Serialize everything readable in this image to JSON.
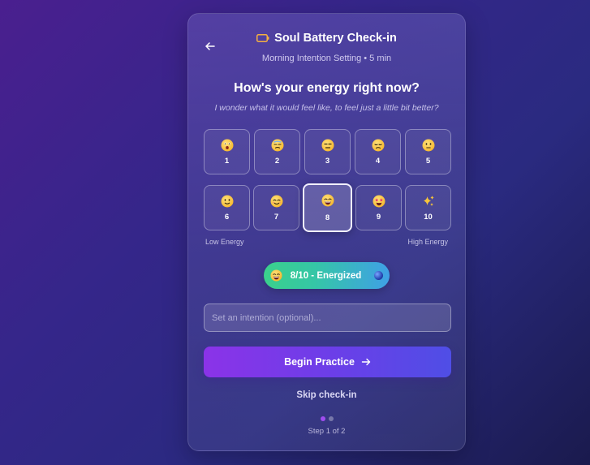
{
  "header": {
    "title": "Soul Battery Check-in",
    "subtitle": "Morning Intention Setting • 5 min",
    "back_icon": "arrow-left-icon",
    "title_icon": "battery-icon",
    "title_icon_color": "#f5b041"
  },
  "prompt": {
    "question": "How's your energy right now?",
    "subtext": "I wonder what it would feel like, to feel just a little bit better?"
  },
  "energy_levels": [
    {
      "value": "1",
      "emoji": "astonished-face"
    },
    {
      "value": "2",
      "emoji": "tired-face"
    },
    {
      "value": "3",
      "emoji": "unamused-face"
    },
    {
      "value": "4",
      "emoji": "disappointed-face"
    },
    {
      "value": "5",
      "emoji": "neutral-face"
    },
    {
      "value": "6",
      "emoji": "slight-smile-face"
    },
    {
      "value": "7",
      "emoji": "smiling-face"
    },
    {
      "value": "8",
      "emoji": "grinning-face"
    },
    {
      "value": "9",
      "emoji": "star-struck-face"
    },
    {
      "value": "10",
      "emoji": "sparkles"
    }
  ],
  "selected_level": 8,
  "scale": {
    "low_label": "Low Energy",
    "high_label": "High Energy"
  },
  "status_pill": {
    "text": "8/10 - Energized",
    "emoji": "grinning-face",
    "gradient_start": "#3bd08c",
    "gradient_end": "#3fa0e6"
  },
  "intention_input": {
    "placeholder": "Set an intention (optional)...",
    "value": ""
  },
  "actions": {
    "begin_label": "Begin Practice",
    "begin_icon": "arrow-right-icon",
    "skip_label": "Skip check-in"
  },
  "progress": {
    "step_label": "Step 1 of 2",
    "current_step": 1,
    "total_steps": 2
  },
  "colors": {
    "accent": "#8b33e8",
    "accent_end": "#4f4ee6"
  }
}
